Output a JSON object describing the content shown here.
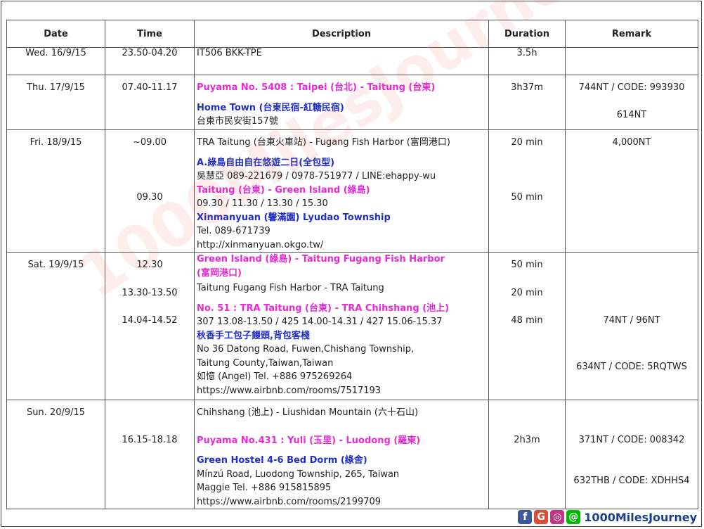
{
  "headers": [
    "Date",
    "Time",
    "Description",
    "Duration",
    "Remark"
  ],
  "rows": [
    {
      "date": "Wed. 16/9/15",
      "time": [
        "23.50-04.20"
      ],
      "desc": [
        {
          "t": "IT506 BKK-TPE",
          "s": "n"
        }
      ],
      "duration": [
        "3.5h"
      ],
      "remark": [
        ""
      ]
    },
    {
      "date": "Thu. 17/9/15",
      "time": [
        "07.40-11.17"
      ],
      "desc": [
        {
          "t": "Puyama No. 5408 : Taipei (台北) - Taitung (台東)",
          "s": "m"
        },
        {
          "t": "",
          "s": "gap"
        },
        {
          "t": "Home Town (台東民宿-紅糖民宿)",
          "s": "b"
        },
        {
          "t": "台東市民安街157號",
          "s": "n"
        }
      ],
      "duration": [
        "3h37m"
      ],
      "remark": [
        "744NT / CODE: 993930",
        "614NT"
      ]
    },
    {
      "date": "Fri. 18/9/15",
      "time": [
        "~09.00",
        "09.30"
      ],
      "desc": [
        {
          "t": "TRA Taitung (台東火車站) - Fugang Fish Harbor (富岡港口)",
          "s": "n"
        },
        {
          "t": "",
          "s": "gap"
        },
        {
          "t": "A.綠島自由自在悠遊二日(全包型)",
          "s": "b"
        },
        {
          "t": "吳慧亞 089-221679 / 0978-751977 / LINE:ehappy-wu",
          "s": "n"
        },
        {
          "t": "Taitung (台東) - Green Island (綠島)",
          "s": "m"
        },
        {
          "t": "09.30 / 11.30 / 13.30 / 15.30",
          "s": "n"
        },
        {
          "t": "Xinmanyuan (馨滿園) Lyudao Township",
          "s": "b"
        },
        {
          "t": "Tel. 089-671739",
          "s": "n"
        },
        {
          "t": "http://xinmanyuan.okgo.tw/",
          "s": "n"
        }
      ],
      "duration": [
        "20 min",
        "50 min"
      ],
      "remark": [
        "4,000NT"
      ]
    },
    {
      "date": "Sat. 19/9/15",
      "time": [
        "12.30",
        "13.30-13.50",
        "14.04-14.52"
      ],
      "desc": [
        {
          "t": "Green Island (綠島) - Taitung Fugang Fish Harbor",
          "s": "m"
        },
        {
          "t": "(富岡港口)",
          "s": "m"
        },
        {
          "t": "Taitung Fugang Fish Harbor - TRA Taitung",
          "s": "n"
        },
        {
          "t": "No. 51 : TRA Taitung (台東) - TRA Chihshang (池上)",
          "s": "m"
        },
        {
          "t": "307 13.08-13.50 / 425 14.00-14.31 / 427 15.06-15.37",
          "s": "n"
        },
        {
          "t": "秋香手工包子饅頭,背包客棧",
          "s": "b"
        },
        {
          "t": "No 36 Datong Road, Fuwen,Chishang Township,",
          "s": "n"
        },
        {
          "t": "Taitung County,Taiwan,Taiwan",
          "s": "n"
        },
        {
          "t": "如憶 (Angel) Tel. +886 975269264",
          "s": "n"
        },
        {
          "t": "https://www.airbnb.com/rooms/7517193",
          "s": "n"
        }
      ],
      "duration": [
        "50 min",
        "20 min",
        "48 min"
      ],
      "remark": [
        "74NT / 96NT",
        "634NT / CODE: 5RQTWS"
      ]
    },
    {
      "date": "Sun. 20/9/15",
      "time": [
        "16.15-18.18"
      ],
      "desc": [
        {
          "t": "Chihshang (池上) - Liushidan Mountain (六十石山)",
          "s": "n"
        },
        {
          "t": "Puyama No.431 : Yuli (玉里) - Luodong (羅東)",
          "s": "m"
        },
        {
          "t": "Green Hostel 4-6 Bed Dorm (綠舍)",
          "s": "b"
        },
        {
          "t": "Mínzú Road, Luodong Township, 265, Taiwan",
          "s": "n"
        },
        {
          "t": "Maggie Tel. +886 915815895",
          "s": "n"
        },
        {
          "t": "https://www.airbnb.com/rooms/2199709",
          "s": "n"
        }
      ],
      "duration": [
        "2h3m"
      ],
      "remark": [
        "371NT / CODE: 008342",
        "632THB / CODE: XDHHS4"
      ]
    }
  ],
  "watermark": "1000MilesJourney",
  "footer": {
    "brand": "1000MilesJourney",
    "icons": [
      {
        "name": "facebook-icon",
        "glyph": "f",
        "color": "#3b5998"
      },
      {
        "name": "google-plus-icon",
        "glyph": "G",
        "color": "#dd4b39"
      },
      {
        "name": "instagram-icon",
        "glyph": "◎",
        "color": "#c13584"
      },
      {
        "name": "line-icon",
        "glyph": "@",
        "color": "#00b900"
      }
    ]
  }
}
